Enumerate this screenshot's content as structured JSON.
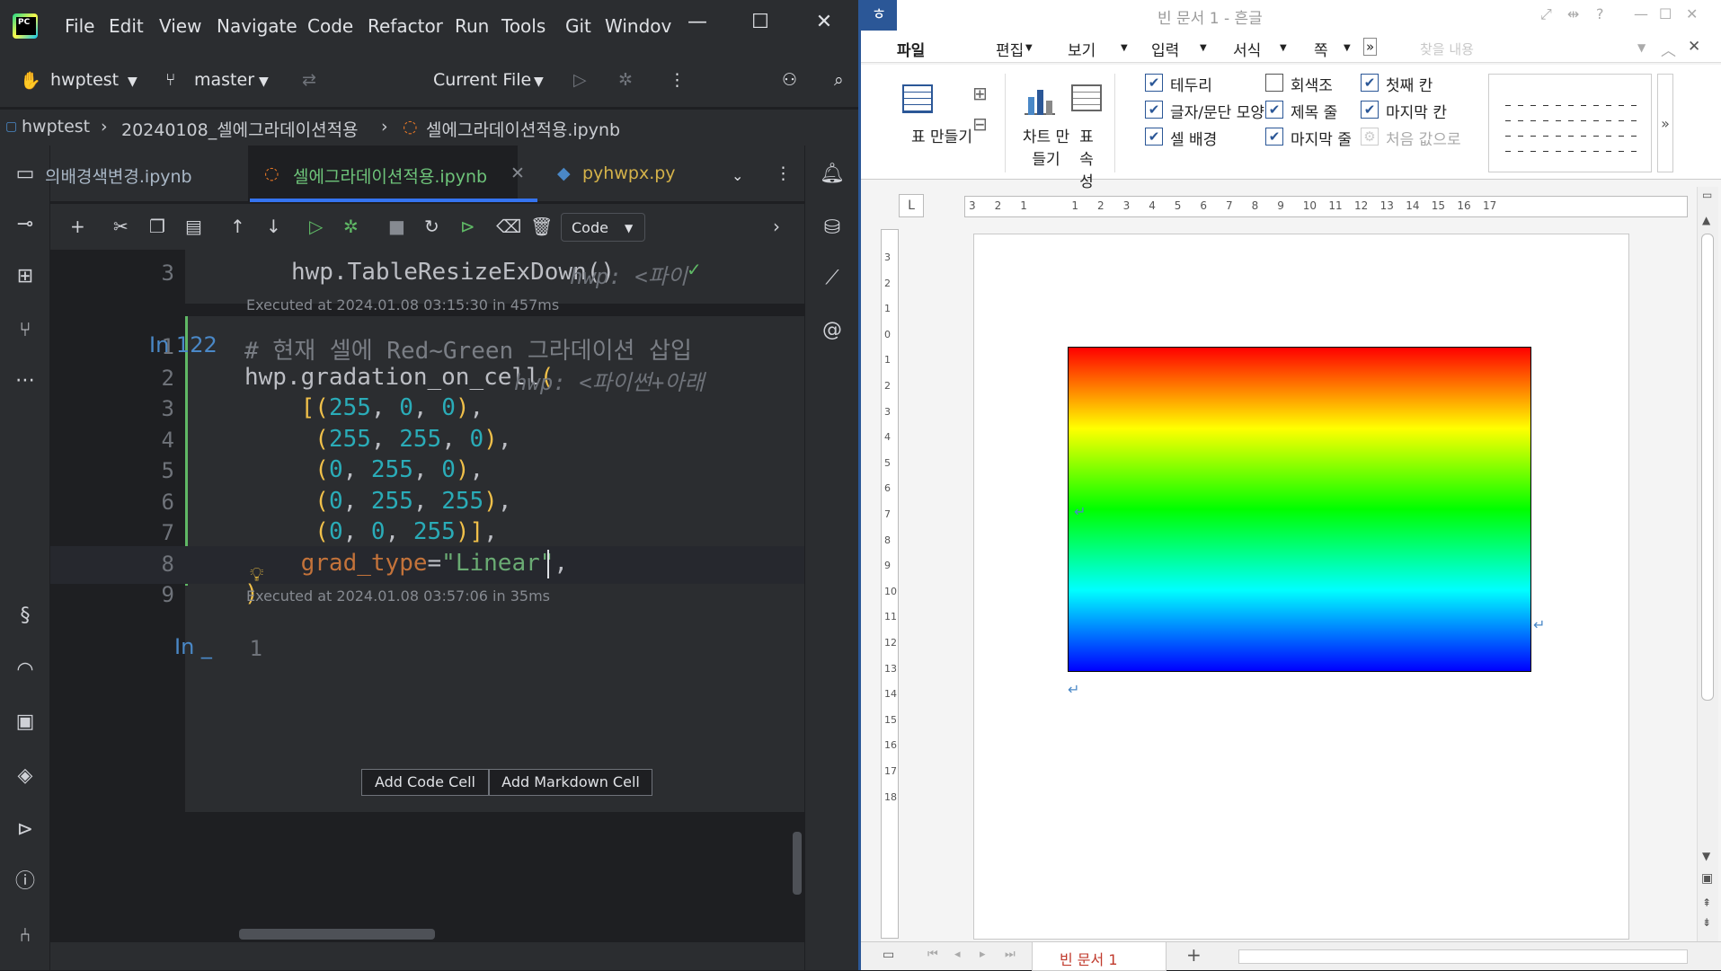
{
  "ide": {
    "menu": [
      "File",
      "Edit",
      "View",
      "Navigate",
      "Code",
      "Refactor",
      "Run",
      "Tools",
      "Git",
      "Windov"
    ],
    "project": "hwptest",
    "branch": "master",
    "run_config": "Current File",
    "breadcrumbs": [
      "hwptest",
      "20240108_셀에그라데이션적용",
      "셀에그라데이션적용.ipynb"
    ],
    "tabs": [
      "의배경색변경.ipynb",
      "셀에그라데이션적용.ipynb",
      "pyhwpx.py"
    ],
    "cell_type": "Code",
    "prev_cell": {
      "line_no": "3",
      "code": "hwp.TableResizeExDown()",
      "hint": "hwp: <파이",
      "executed": "Executed at 2024.01.08 03:15:30 in 457ms"
    },
    "cell": {
      "prompt": "In 122",
      "lines": [
        {
          "no": "1",
          "text": "# 현재 셀에 Red~Green 그라데이션 삽입"
        },
        {
          "no": "2",
          "text": "hwp.gradation_on_cell(",
          "hint": "hwp: <파이썬+아래"
        },
        {
          "no": "3",
          "text": "    [(255, 0, 0),"
        },
        {
          "no": "4",
          "text": "     (255, 255, 0),"
        },
        {
          "no": "5",
          "text": "     (0, 255, 0),"
        },
        {
          "no": "6",
          "text": "     (0, 255, 255),"
        },
        {
          "no": "7",
          "text": "     (0, 0, 255)],"
        },
        {
          "no": "8",
          "text": "    grad_type=\"Linear\","
        },
        {
          "no": "9",
          "text": ")"
        }
      ],
      "executed": "Executed at 2024.01.08 03:57:06 in 35ms"
    },
    "empty_cell": {
      "prompt": "In _",
      "line_no": "1"
    },
    "buttons": [
      "Add Code Cell",
      "Add Markdown Cell"
    ]
  },
  "hwp": {
    "title": "빈 문서 1 - 흔글",
    "menu": [
      "파일",
      "편집",
      "보기",
      "입력",
      "서식",
      "쪽"
    ],
    "search_placeholder": "찾을 내용",
    "ribbon": {
      "big": [
        {
          "label": "표 만들기"
        },
        {
          "label": "차트 만들기"
        },
        {
          "label": "표 속성"
        }
      ],
      "checks": [
        {
          "label": "테두리",
          "on": true
        },
        {
          "label": "글자/문단 모양",
          "on": true
        },
        {
          "label": "셀 배경",
          "on": true
        },
        {
          "label": "회색조",
          "on": false
        },
        {
          "label": "제목 줄",
          "on": true
        },
        {
          "label": "마지막 줄",
          "on": true
        },
        {
          "label": "첫째 칸",
          "on": true
        },
        {
          "label": "마지막 칸",
          "on": true
        },
        {
          "label": "처음 값으로",
          "on": false
        }
      ]
    },
    "ruler_ticks": [
      "3",
      "2",
      "1",
      "",
      "1",
      "2",
      "3",
      "4",
      "5",
      "6",
      "7",
      "8",
      "9",
      "10",
      "11",
      "12",
      "13",
      "14",
      "15",
      "16",
      "17"
    ],
    "vruler_ticks": [
      "3",
      "2",
      "1",
      "0",
      "1",
      "2",
      "3",
      "4",
      "5",
      "6",
      "7",
      "8",
      "9",
      "10",
      "11",
      "12",
      "13",
      "14",
      "15",
      "16",
      "17",
      "18"
    ],
    "doc_tab": "빈 문서 1",
    "gradient": [
      "#ff0000",
      "#ffff00",
      "#00ff00",
      "#00ffff",
      "#0000ff"
    ]
  }
}
